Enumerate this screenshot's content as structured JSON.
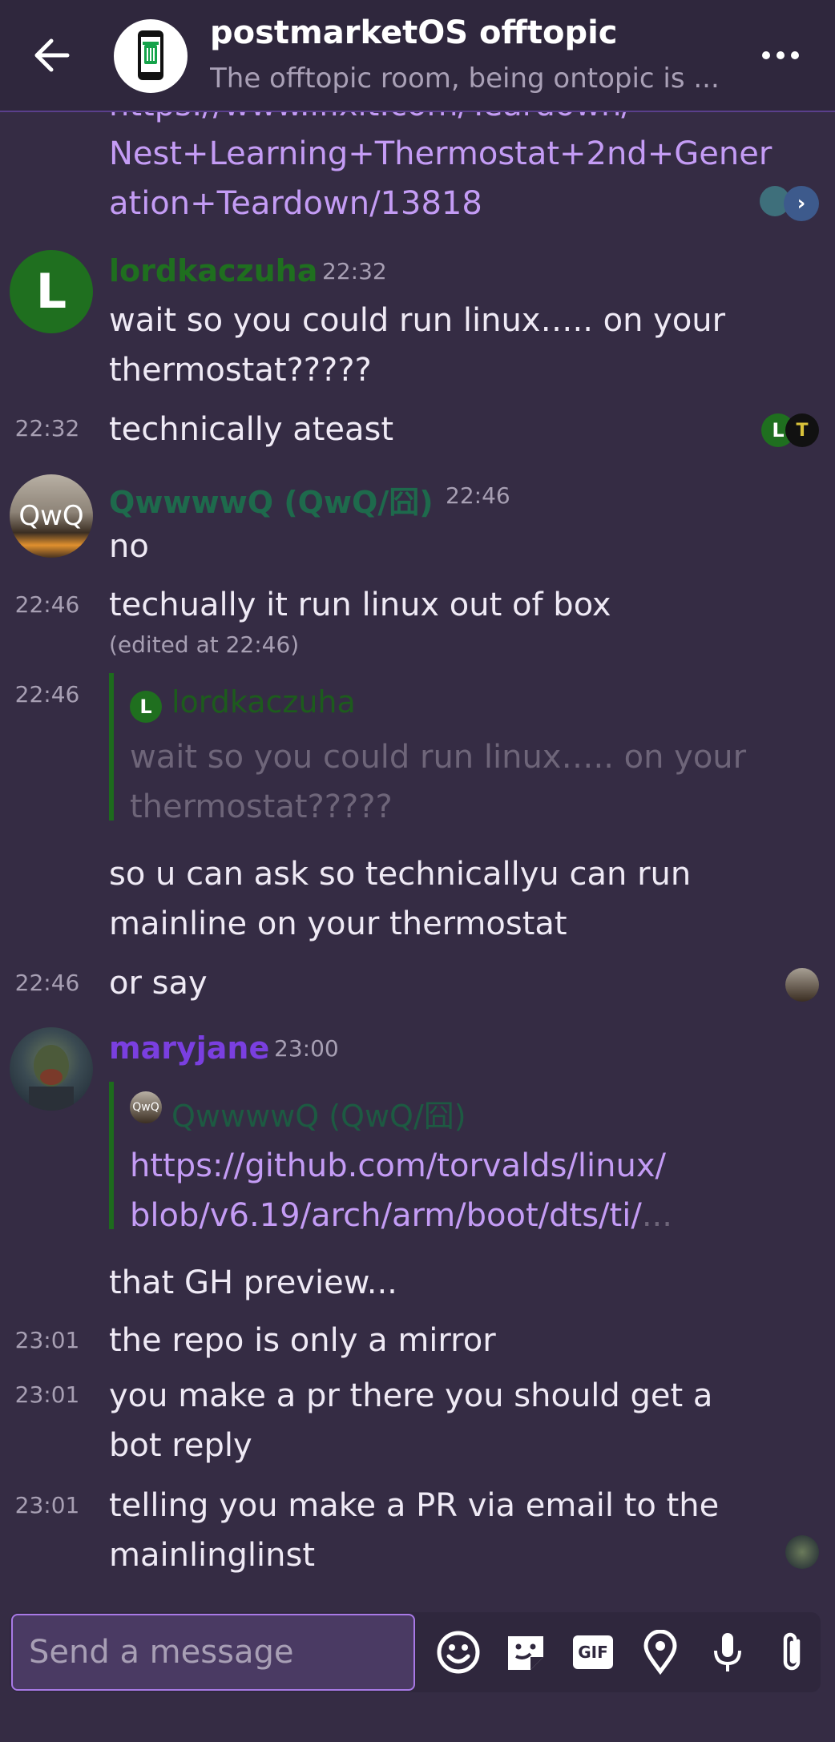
{
  "header": {
    "title": "postmarketOS offtopic",
    "topic": "The offtopic room, being ontopic is ..."
  },
  "messages": {
    "link_partial": "https://www.ifixit.com/Teardown/",
    "link_line1": "Nest+Learning+Thermostat+2nd+Gener",
    "link_line2": "ation+Teardown/13818",
    "m1": {
      "sender": "lordkaczuha",
      "avatar_letter": "L",
      "time": "22:32",
      "line1": "wait so you could run linux….. on your",
      "line2": "thermostat?????"
    },
    "m2": {
      "time": "22:32",
      "text": "technically ateast"
    },
    "m3": {
      "sender": "QwwwwQ (QwQ/囧)",
      "avatar_text": "QwQ",
      "time": "22:46",
      "text": "no"
    },
    "m4": {
      "time": "22:46",
      "text": "techually it run linux out of box",
      "edited": "(edited at 22:46)"
    },
    "m5": {
      "time": "22:46",
      "quote_sender": "lordkaczuha",
      "quote_avatar": "L",
      "quote_line1": "wait so you could run linux….. on your",
      "quote_line2": "thermostat?????",
      "line1": "so u can ask so technicallyu can run",
      "line2": "mainline on your thermostat"
    },
    "m6": {
      "time": "22:46",
      "text": "or say"
    },
    "m7": {
      "sender": "maryjane",
      "time": "23:00",
      "quote_sender": "QwwwwQ (QwQ/囧)",
      "quote_avatar": "QwQ",
      "quote_link1": "https://github.com/torvalds/linux/",
      "quote_link2": "blob/v6.19/arch/arm/boot/dts/ti/",
      "quote_ellipsis": "...",
      "text": "that GH preview..."
    },
    "m8": {
      "time": "23:01",
      "text": "the repo is only a mirror"
    },
    "m9": {
      "time": "23:01",
      "line1": "you make a pr there you should get a",
      "line2": "bot reply"
    },
    "m10": {
      "time": "23:01",
      "line1": "telling you make a PR via email to the",
      "line2": "mainlinglinst"
    }
  },
  "receipts": {
    "r2_letter": "L",
    "r2_second": "T"
  },
  "composer": {
    "placeholder": "Send a message",
    "gif_label": "GIF"
  },
  "colors": {
    "accent": "#a879e6",
    "link": "#c49cf5",
    "sender_lordkaczuha": "#1f6f1f",
    "sender_qwq": "#1e6a4c",
    "sender_maryjane": "#7a3fe0",
    "background": "#352c44"
  },
  "icons": [
    "back-arrow-icon",
    "trash-phone-room-icon",
    "more-menu-icon",
    "emoji-icon",
    "sticker-icon",
    "gif-icon",
    "location-icon",
    "microphone-icon",
    "attachment-icon"
  ]
}
